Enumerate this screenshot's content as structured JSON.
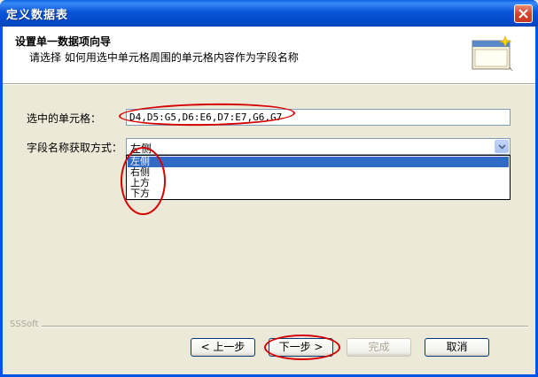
{
  "window": {
    "title": "定义数据表"
  },
  "header": {
    "title": "设置单一数据项向导",
    "subtitle": "请选择 如何用选中单元格周围的单元格内容作为字段名称"
  },
  "form": {
    "cells_label": "选中的单元格：",
    "cells_value": "D4,D5:G5,D6:E6,D7:E7,G6,G7",
    "field_name_label": "字段名称获取方式：",
    "field_name_value": "左侧",
    "options": [
      "左侧",
      "右侧",
      "上方",
      "下方"
    ],
    "selected_index": 0
  },
  "footer": {
    "brand": "SSSoft",
    "prev_label": "< 上一步",
    "next_label": "下一步 >",
    "finish_label": "完成",
    "cancel_label": "取消"
  },
  "colors": {
    "titlebar": "#0a55d8",
    "selection": "#316ac5",
    "annotation": "#d40000"
  }
}
